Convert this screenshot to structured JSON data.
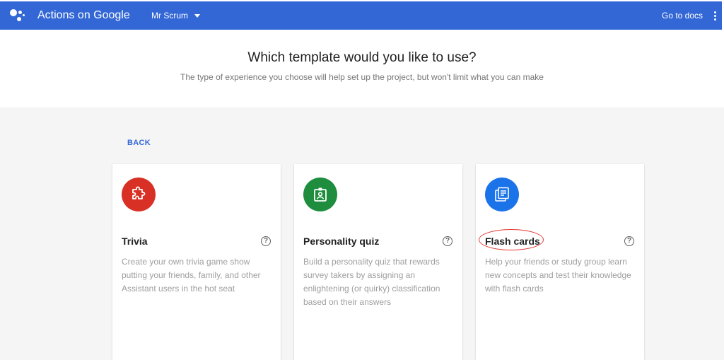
{
  "topbar": {
    "app_title": "Actions on Google",
    "project_name": "Mr Scrum",
    "docs_link": "Go to docs",
    "bg_color": "#3367d6"
  },
  "header": {
    "title": "Which template would you like to use?",
    "subtitle": "The type of experience you choose will help set up the project, but won't limit what you can make"
  },
  "back_label": "BACK",
  "cards": [
    {
      "title": "Trivia",
      "description": "Create your own trivia game show putting your friends, family, and other Assistant users in the hot seat",
      "icon": "puzzle-icon",
      "icon_color": "#d93025"
    },
    {
      "title": "Personality quiz",
      "description": "Build a personality quiz that rewards survey takers by assigning an enlightening (or quirky) classification based on their answers",
      "icon": "id-badge-icon",
      "icon_color": "#1e8e3e"
    },
    {
      "title": "Flash cards",
      "description": "Help your friends or study group learn new concepts and test their knowledge with flash cards",
      "icon": "cards-icon",
      "icon_color": "#1a73e8",
      "annotated": true
    }
  ]
}
